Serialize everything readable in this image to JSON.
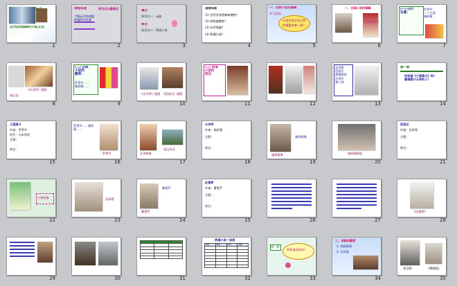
{
  "app": {
    "view": "slide-sorter"
  },
  "slides": [
    {
      "num": "1",
      "title": "第一节",
      "subtitle": "古代的戏曲和小说文化",
      "colors": {
        "title": "#3a8f3a"
      }
    },
    {
      "num": "2",
      "text1": "课程标准",
      "text2": "知识点与重难点",
      "text3": "了解元代的戏曲\n知道四大名著"
    },
    {
      "num": "3",
      "text1": "重点",
      "text2": "知识点一：元曲",
      "text3": "难点",
      "text4": "知识点二：明清小说"
    },
    {
      "num": "4",
      "text1": "温故知新",
      "q1": "(1) 古代文学经典有哪些？",
      "q2": "(2) 你知道哪些？",
      "q3": "(3) 元代戏曲？",
      "q4": "(4) 明清小说？"
    },
    {
      "num": "5",
      "text1": "一、古典小说的高峰",
      "text2": "学习目标",
      "text3": "小说大致分为三种",
      "text4": "你最喜欢哪一部？"
    },
    {
      "num": "6",
      "text1": "一、古典小说的高峰",
      "label": "《三国演义》"
    },
    {
      "num": "7",
      "text1": "(一) 四大\n名著：",
      "text2": "罗贯中\n——三国\n施耐庵"
    },
    {
      "num": "8",
      "caption": "《水浒传》插图",
      "caption2": "梁山泊"
    },
    {
      "num": "9",
      "text1": "(二) 古典\n小说的\n繁荣：",
      "text2": "罗贯中……\n施耐庵……"
    },
    {
      "num": "10",
      "caption1": "《水浒传》插图",
      "caption2": "《西游记》插图"
    },
    {
      "num": "11",
      "text1": "(三) 明清\n小说的\n特点："
    },
    {
      "num": "12"
    },
    {
      "num": "13",
      "text1": "吴承恩\n西游记\n唐僧取经\n孙悟空\n猪八戒"
    },
    {
      "num": "14",
      "text1": "想一想",
      "text2": "你知道《三国演义》吗？\n曹操是什么样的人？"
    },
    {
      "num": "15",
      "text1": "三国演义",
      "f1": "作者：罗贯中",
      "f2": "时代：元末明初",
      "f3": "主题：",
      "f4": "地位："
    },
    {
      "num": "16",
      "text1": "罗贯中……施耐庵……",
      "caption": "罗贯中"
    },
    {
      "num": "17",
      "caption1": "水浒故事",
      "caption2": "梁山风光"
    },
    {
      "num": "18",
      "text1": "水浒传",
      "f1": "作者：施耐庵",
      "f2": "主题：",
      "f3": "地位："
    },
    {
      "num": "19",
      "caption": "施耐庵像"
    },
    {
      "num": "20",
      "caption": "施耐庵故居"
    },
    {
      "num": "21",
      "text1": "西游记",
      "f1": "作者：吴承恩",
      "f2": "主题：",
      "f3": "地位："
    },
    {
      "num": "22",
      "caption": "人物形象"
    },
    {
      "num": "23",
      "caption": "吴承恩"
    },
    {
      "num": "24",
      "caption": "曹雪芹"
    },
    {
      "num": "25",
      "text1": "红楼梦",
      "f1": "作者：曹雪芹",
      "f2": "主题：",
      "f3": "地位："
    },
    {
      "num": "26"
    },
    {
      "num": "27"
    },
    {
      "num": "28",
      "caption": "《红楼梦》"
    },
    {
      "num": "29"
    },
    {
      "num": "30"
    },
    {
      "num": "31"
    },
    {
      "num": "32",
      "title": "明清小说一览表",
      "heads": [
        "书名",
        "作者",
        "年代",
        "主题"
      ]
    },
    {
      "num": "33",
      "text1": "想一想",
      "text2": "你知道这些吗？"
    },
    {
      "num": "34",
      "text1": "二、戏剧的繁荣",
      "text2": "1. 戏剧表演",
      "text3": "2. 元杂剧"
    },
    {
      "num": "35",
      "caption1": "关汉卿",
      "caption2": "《窦娥冤》"
    }
  ]
}
